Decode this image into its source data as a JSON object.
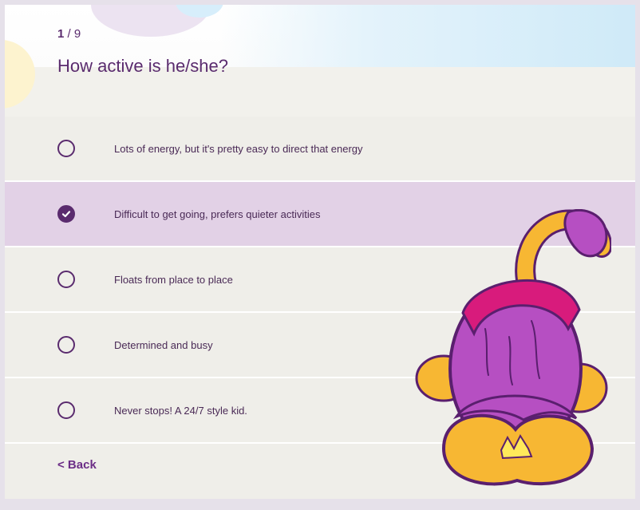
{
  "progress": {
    "current": "1",
    "total": "/ 9"
  },
  "question": "How active is he/she?",
  "options": [
    {
      "label": "Lots of energy, but it's pretty easy to direct that energy",
      "selected": false
    },
    {
      "label": "Difficult to get going, prefers quieter activities",
      "selected": true
    },
    {
      "label": "Floats from place to place",
      "selected": false
    },
    {
      "label": "Determined and busy",
      "selected": false
    },
    {
      "label": "Never stops! A 24/7 style kid.",
      "selected": false
    }
  ],
  "back_label": "< Back",
  "colors": {
    "accent": "#5a2b6e",
    "selected_row": "#e2d1e6",
    "row": "#efeee9",
    "mascot_body": "#b64fc2",
    "mascot_fur": "#f7b733",
    "mascot_shirt": "#d81b7c"
  },
  "icons": {
    "selected": "check-circle-icon",
    "unselected": "radio-empty-icon",
    "illustration": "purple-monster-mascot"
  }
}
